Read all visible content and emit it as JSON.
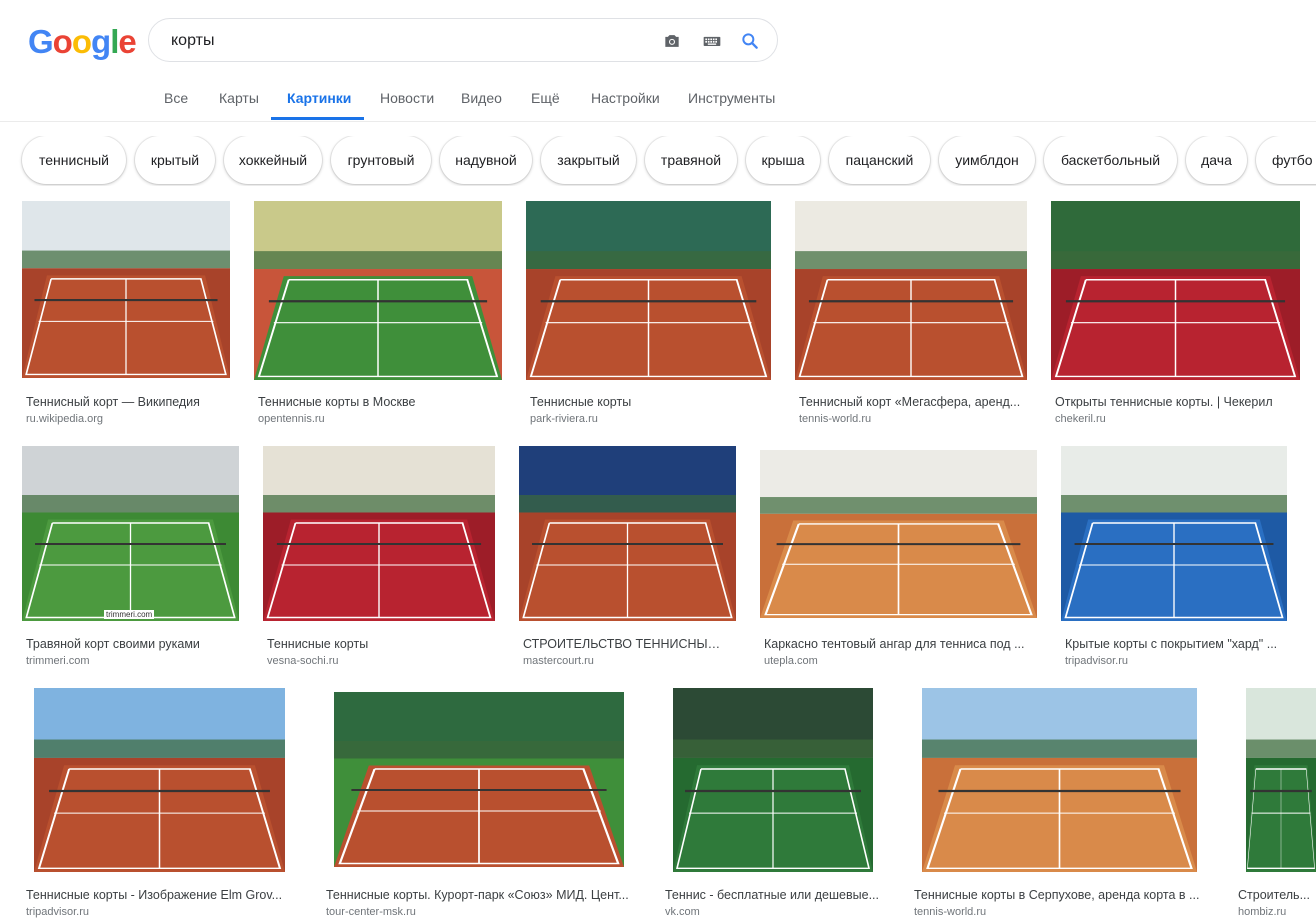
{
  "logo": {
    "letters": [
      "G",
      "o",
      "o",
      "g",
      "l",
      "e"
    ]
  },
  "search": {
    "query": "корты"
  },
  "icons": {
    "camera": "camera-icon",
    "keyboard": "keyboard-icon",
    "search": "search-icon"
  },
  "tabs": [
    {
      "label": "Все"
    },
    {
      "label": "Карты"
    },
    {
      "label": "Картинки",
      "active": true
    },
    {
      "label": "Новости"
    },
    {
      "label": "Видео"
    },
    {
      "label": "Ещё"
    },
    {
      "label": "Настройки"
    },
    {
      "label": "Инструменты"
    }
  ],
  "chips": [
    "теннисный",
    "крытый",
    "хоккейный",
    "грунтовый",
    "надувной",
    "закрытый",
    "травяной",
    "крыша",
    "пацанский",
    "уимблдон",
    "баскетбольный",
    "дача",
    "футбо"
  ],
  "colors": {
    "accent": "#1a73e8",
    "clay": "#b5492f",
    "grass": "#3f8f3a",
    "blue_court": "#2a6fc2",
    "red_court": "#b8222a"
  },
  "results": [
    {
      "caption": "Теннисный корт — Википедия",
      "domain": "ru.wikipedia.org",
      "surface": "clay",
      "sky": "#dfe6ea"
    },
    {
      "caption": "Теннисные корты в Москве",
      "domain": "opentennis.ru",
      "surface": "grass_clay",
      "sky": "#c9c98a"
    },
    {
      "caption": "Теннисные корты",
      "domain": "park-riviera.ru",
      "surface": "clay",
      "sky": "#2d6a55"
    },
    {
      "caption": "Теннисный корт «Мегасфера, аренд...",
      "domain": "tennis-world.ru",
      "surface": "clay",
      "sky": "#eceae2"
    },
    {
      "caption": "Открыты теннисные корты. | Чекерил",
      "domain": "chekeril.ru",
      "surface": "red",
      "sky": "#2f6a3a"
    },
    {
      "caption": "Травяной корт своими руками",
      "domain": "trimmeri.com",
      "surface": "grass",
      "sky": "#cfd3d6",
      "watermark": "trimmeri.com"
    },
    {
      "caption": "Теннисные корты",
      "domain": "vesna-sochi.ru",
      "surface": "red",
      "sky": "#e5e1d5"
    },
    {
      "caption": "СТРОИТЕЛЬСТВО ТЕННИСНЫХ ...",
      "domain": "mastercourt.ru",
      "surface": "clay",
      "sky": "#1f3f7a"
    },
    {
      "caption": "Каркасно тентовый ангар для тенниса под ...",
      "domain": "utepla.com",
      "surface": "orange",
      "sky": "#ecebe6"
    },
    {
      "caption": "Крытые корты с покрытием \"хард\" ...",
      "domain": "tripadvisor.ru",
      "surface": "blue",
      "sky": "#e8ece8"
    },
    {
      "caption": "Теннисные корты - Изображение Elm Grov...",
      "domain": "tripadvisor.ru",
      "surface": "clay",
      "sky": "#7fb3e0"
    },
    {
      "caption": "Теннисные корты. Курорт-парк «Союз» МИД. Цент...",
      "domain": "tour-center-msk.ru",
      "surface": "clay_grass",
      "sky": "#2e6a3f"
    },
    {
      "caption": "Теннис - бесплатные или дешевые...",
      "domain": "vk.com",
      "surface": "green",
      "sky": "#2c4a35"
    },
    {
      "caption": "Теннисные корты в Серпухове, аренда корта в ...",
      "domain": "tennis-world.ru",
      "surface": "orange",
      "sky": "#9cc4e6"
    },
    {
      "caption": "Строитель...",
      "domain": "hombiz.ru",
      "surface": "green",
      "sky": "#d9e6dc"
    }
  ]
}
